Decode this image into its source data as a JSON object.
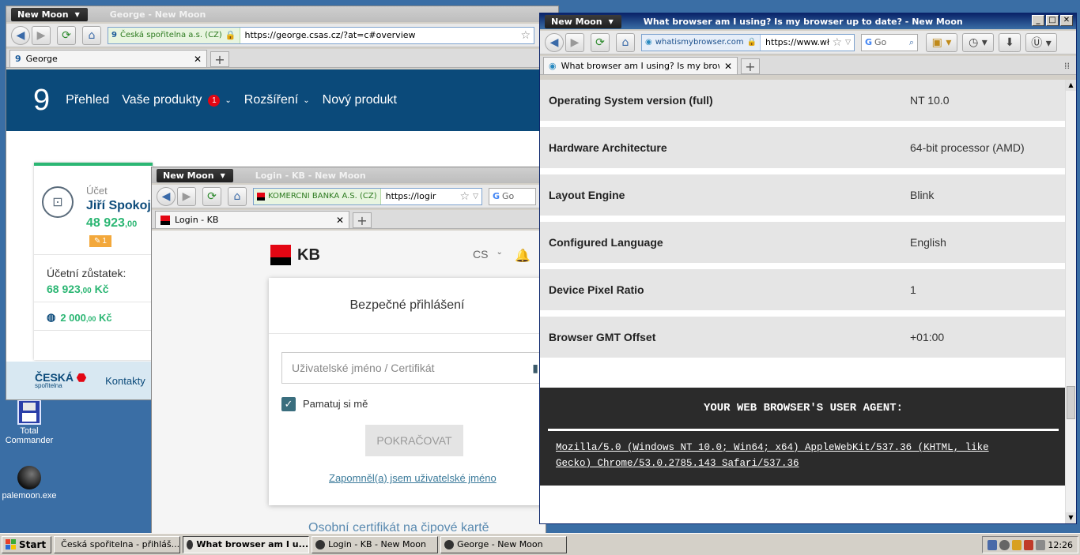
{
  "desktop": {
    "icons": [
      {
        "label": "Total Commander"
      },
      {
        "label": "palemoon.exe"
      }
    ]
  },
  "app_menu_label": "New Moon",
  "george_window": {
    "title": "George - New Moon",
    "identity": "Česká spořitelna a.s. (CZ)",
    "url": "https://george.csas.cz/?at=c#overview",
    "tab_title": "George",
    "logo": "9",
    "nav": [
      "Přehled",
      "Vaše produkty",
      "Rozšíření",
      "Nový produkt"
    ],
    "nav_badge": "1",
    "card": {
      "label": "Účet",
      "name": "Jiří Spokoj",
      "amount_main": "48 923",
      "amount_dec": ",00",
      "edit_badge": "1",
      "balance_label": "Účetní zůstatek:",
      "balance_main": "68 923",
      "balance_dec": ",00",
      "balance_cur": "Kč",
      "savings_main": "2 000",
      "savings_dec": ",00",
      "savings_cur": "Kč"
    },
    "footer_logo_main": "ČESKÁ",
    "footer_logo_sub": "spořitelna",
    "footer_link": "Kontakty"
  },
  "kb_window": {
    "title": "Login - KB - New Moon",
    "identity": "KOMERCNI BANKA A.S. (CZ)",
    "url": "https://logir",
    "search_placeholder": "Go",
    "tab_title": "Login - KB",
    "logo_text": "KB",
    "lang": "CS",
    "login_title": "Bezpečné přihlášení",
    "username_placeholder": "Uživatelské jméno / Certifikát",
    "remember_label": "Pamatuj si mě",
    "continue_label": "POKRAČOVAT",
    "forgot_link": "Zapomněl(a) jsem uživatelské jméno",
    "bottom_text": "Osobní certifikát na čipové kartě"
  },
  "wmb_window": {
    "title": "What browser am I using? Is my browser up to date? - New Moon",
    "identity": "whatismybrowser.com",
    "url": "https://www.wł",
    "search_placeholder": "Go",
    "tab_title": "What browser am I using? Is my browser...",
    "rows": [
      {
        "key": "Operating System version (full)",
        "value": "NT 10.0"
      },
      {
        "key": "Hardware Architecture",
        "value": "64-bit processor (AMD)"
      },
      {
        "key": "Layout Engine",
        "value": "Blink"
      },
      {
        "key": "Configured Language",
        "value": "English"
      },
      {
        "key": "Device Pixel Ratio",
        "value": "1"
      },
      {
        "key": "Browser GMT Offset",
        "value": "+01:00"
      }
    ],
    "ua_heading": "YOUR WEB BROWSER'S USER AGENT:",
    "ua_line1": "Mozilla/5.0 (Windows NT 10.0; Win64; x64) AppleWebKit/537.36 (KHTML, like",
    "ua_line2": "Gecko) Chrome/53.0.2785.143 Safari/537.36"
  },
  "taskbar": {
    "start": "Start",
    "items": [
      {
        "label": "Česká spořitelna - přihláš..."
      },
      {
        "label": "What browser am I u..."
      },
      {
        "label": "Login - KB - New Moon"
      },
      {
        "label": "George - New Moon"
      }
    ],
    "clock": "12:26"
  },
  "colors": {
    "desktop": "#3a6ea5",
    "george_header": "#0b4a7a",
    "george_green": "#2bb673",
    "kb_red": "#e30613",
    "ua_box": "#2b2b2b"
  }
}
